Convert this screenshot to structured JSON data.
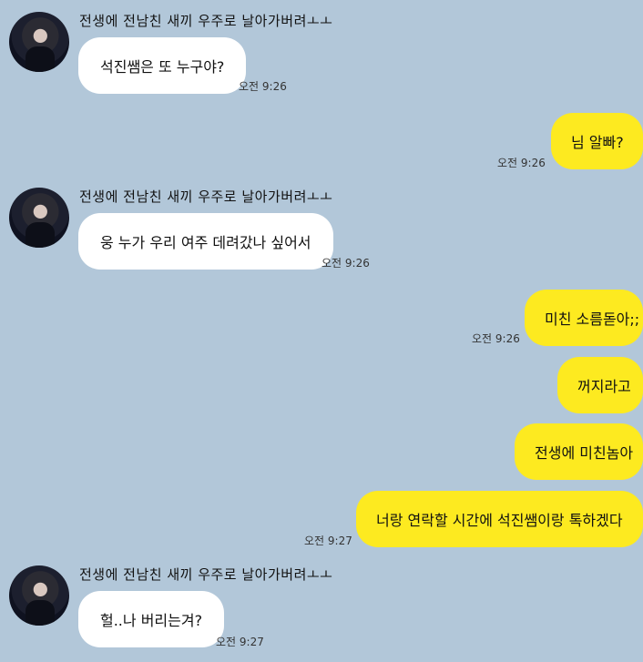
{
  "chat": {
    "sender_name": "전생에 전남친 새끼 우주로 날아가버려ㅗㅗ",
    "messages": [
      {
        "from": "them",
        "text": "석진쌤은 또 누구야?",
        "time": "오전 9:26"
      },
      {
        "from": "me",
        "text": "님 알빠?",
        "time": "오전 9:26"
      },
      {
        "from": "them",
        "text": "웅 누가 우리 여주 데려갔나 싶어서",
        "time": "오전 9:26"
      },
      {
        "from": "me",
        "text": "미친 소름돋아;;",
        "time": "오전 9:26"
      },
      {
        "from": "me",
        "text": "꺼지라고",
        "time": ""
      },
      {
        "from": "me",
        "text": "전생에 미친놈아",
        "time": ""
      },
      {
        "from": "me",
        "text": "너랑 연락할 시간에 석진쌤이랑 톡하겠다",
        "time": "오전 9:27"
      },
      {
        "from": "them",
        "text": "헐..나 버리는겨?",
        "time": "오전 9:27"
      }
    ]
  },
  "colors": {
    "background": "#b2c7d9",
    "sent_bubble": "#fdea20",
    "received_bubble": "#ffffff"
  },
  "icons": {
    "avatar": "profile-photo"
  }
}
